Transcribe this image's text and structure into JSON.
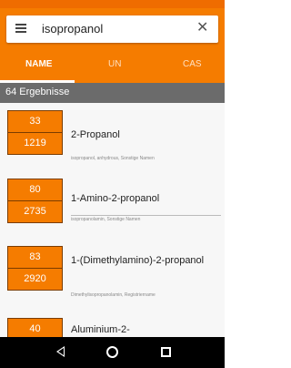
{
  "search": {
    "query": "isopropanol"
  },
  "tabs": [
    {
      "label": "NAME",
      "active": true
    },
    {
      "label": "UN",
      "active": false
    },
    {
      "label": "CAS",
      "active": false
    }
  ],
  "results": {
    "summary": "64 Ergebnisse"
  },
  "items": [
    {
      "un": "33",
      "cas": "1219",
      "name": "2-Propanol",
      "sub": "isopropanol, anhydrous, Sonstige Namen"
    },
    {
      "un": "80",
      "cas": "2735",
      "name": "1-Amino-2-propanol",
      "sub": "isopropanolamin, Sonstige Namen"
    },
    {
      "un": "83",
      "cas": "2920",
      "name": "1-(Dimethylamino)-2-propanol",
      "sub": "Dimethylisopropanolamin, Registriername"
    },
    {
      "un": "40",
      "cas": "",
      "name": "Aluminium-2-",
      "sub": ""
    }
  ],
  "colors": {
    "accent": "#f57c00",
    "header_gray": "#6b6b6b"
  },
  "icons": {
    "menu": "hamburger-menu-icon",
    "clear": "close-icon",
    "back": "back-triangle-icon",
    "home": "home-circle-icon",
    "recent": "recent-apps-square-icon"
  }
}
